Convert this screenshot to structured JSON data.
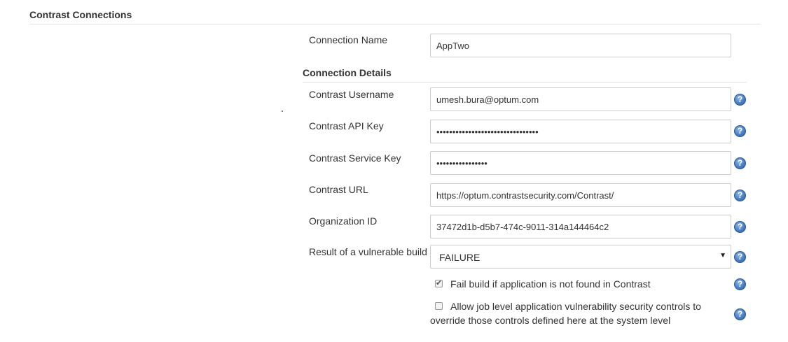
{
  "section": {
    "title": "Contrast Connections"
  },
  "connection": {
    "label": "Connection Name",
    "value": "AppTwo"
  },
  "details": {
    "title": "Connection Details",
    "fields": [
      {
        "label": "Contrast Username",
        "value": "umesh.bura@optum.com"
      },
      {
        "label": "Contrast API Key",
        "value": "••••••••••••••••••••••••••••••••"
      },
      {
        "label": "Contrast Service Key",
        "value": "••••••••••••••••"
      },
      {
        "label": "Contrast URL",
        "value": "https://optum.contrastsecurity.com/Contrast/"
      },
      {
        "label": "Organization ID",
        "value": "37472d1b-d5b7-474c-9011-314a144464c2"
      }
    ],
    "result": {
      "label": "Result of a vulnerable build",
      "selected": "FAILURE"
    },
    "checkboxes": [
      {
        "label": "Fail build if application is not found in Contrast",
        "checked": true
      },
      {
        "label_line1": "Allow job level application vulnerability security controls to",
        "label_line2": "override those controls defined here at the system level",
        "checked": false
      }
    ]
  },
  "icons": {
    "help": "help-icon",
    "arrow": "dropdown-arrow-icon"
  },
  "help_glyph": "?",
  "arrow_glyph": "▼"
}
